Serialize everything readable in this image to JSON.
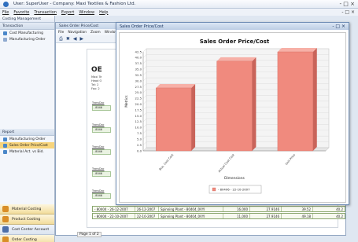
{
  "window": {
    "title": "User: SuperUser - Company: Maxi Textiles & Fashion Ltd.",
    "controls": "- □ ×"
  },
  "menubar": {
    "items": [
      "File",
      "Favorite",
      "Transaction",
      "Export",
      "Window",
      "Help"
    ]
  },
  "left": {
    "header": "Costing Management",
    "transaction_header": "Transaction",
    "transaction_items": [
      "Cost Manufacturing",
      "Manufacturing Order"
    ],
    "report_header": "Report",
    "report_items": [
      "Manufacturing Order",
      "Sales Order Price/Cost",
      "Material Act. vs Bid."
    ],
    "bottom_items": [
      "Material Costing",
      "Product Costing",
      "Cost Center Account",
      "Order Costing"
    ]
  },
  "report_window": {
    "title": "Sales Order Price/Cost",
    "menu": [
      "File",
      "Navigation",
      "Zoom",
      "Window"
    ],
    "brand": "OE",
    "header_lines": [
      "Maxi Te",
      "Head O",
      "Tel: 2",
      "Fax: 2"
    ],
    "filter_labels": [
      "TransDoc",
      "TransDoc",
      "TransDoc",
      "TransDoc",
      "TransDoc"
    ],
    "filter_value": "- 8046",
    "rows": [
      {
        "order": "- 80404 - 26-12-2007",
        "date": "26-12-2007",
        "desc": "Spinning Plant - 80404_0VYI",
        "qty": "16,000",
        "a": "27.9146",
        "b": "39.52",
        "c": "40.2"
      },
      {
        "order": "- 80404 - 22-10-2007",
        "date": "22-10-2007",
        "desc": "Spinning Plant - 80404_0VYI",
        "qty": "11,000",
        "a": "27.9146",
        "b": "49.18",
        "c": "40.2"
      }
    ],
    "page_info": "Page 1 of 2"
  },
  "chart_window": {
    "title": "Sales Order Price/Cost",
    "controls": "- □ ×"
  },
  "chart_data": {
    "type": "bar",
    "title": "Sales Order Price/Cost",
    "xlabel": "Dimensions",
    "ylabel": "Metrics",
    "categories": [
      "Bus. Cost Cost",
      "Actual Cost Cost",
      "Unit Price"
    ],
    "series": [
      {
        "name": "- 80406 - 22-10-2007",
        "values": [
          27.0,
          38.5,
          42.5
        ]
      }
    ],
    "ylim": [
      0,
      42.5
    ],
    "yticks": [
      0,
      2.5,
      5,
      7.5,
      10,
      12.5,
      15,
      17.5,
      20,
      22.5,
      25,
      27.5,
      30,
      32.5,
      35,
      37.5,
      40,
      42.5
    ],
    "grid": true,
    "legend": "bottom",
    "bar_color": "#f08a7e"
  }
}
